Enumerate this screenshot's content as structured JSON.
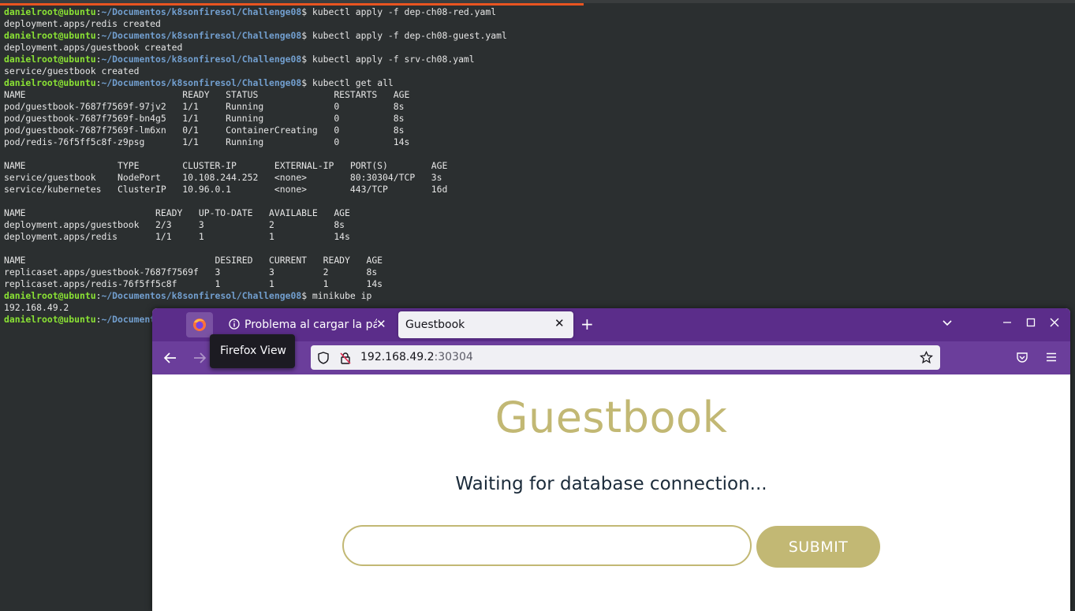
{
  "colors": {
    "terminal_bg": "#2b2f30",
    "prompt_user": "#8ae234",
    "prompt_path": "#729fcf",
    "firefox_tabbar": "#5b2d8a",
    "firefox_navbar": "#6b3e9b",
    "guestbook_accent": "#c2b874"
  },
  "terminal": {
    "prompt_user": "danielroot@ubuntu",
    "prompt_path": "~/Documentos/k8sonfiresol/Challenge08",
    "lines": [
      {
        "type": "prompt",
        "cmd": "$ kubectl apply -f dep-ch08-red.yaml"
      },
      {
        "type": "out",
        "text": "deployment.apps/redis created"
      },
      {
        "type": "prompt",
        "cmd": "$ kubectl apply -f dep-ch08-guest.yaml"
      },
      {
        "type": "out",
        "text": "deployment.apps/guestbook created"
      },
      {
        "type": "prompt",
        "cmd": "$ kubectl apply -f srv-ch08.yaml"
      },
      {
        "type": "out",
        "text": "service/guestbook created"
      },
      {
        "type": "prompt",
        "cmd": "$ kubectl get all"
      },
      {
        "type": "out",
        "text": "NAME                             READY   STATUS              RESTARTS   AGE"
      },
      {
        "type": "out",
        "text": "pod/guestbook-7687f7569f-97jv2   1/1     Running             0          8s"
      },
      {
        "type": "out",
        "text": "pod/guestbook-7687f7569f-bn4g5   1/1     Running             0          8s"
      },
      {
        "type": "out",
        "text": "pod/guestbook-7687f7569f-lm6xn   0/1     ContainerCreating   0          8s"
      },
      {
        "type": "out",
        "text": "pod/redis-76f5ff5c8f-z9psg       1/1     Running             0          14s"
      },
      {
        "type": "out",
        "text": ""
      },
      {
        "type": "out",
        "text": "NAME                 TYPE        CLUSTER-IP       EXTERNAL-IP   PORT(S)        AGE"
      },
      {
        "type": "out",
        "text": "service/guestbook    NodePort    10.108.244.252   <none>        80:30304/TCP   3s"
      },
      {
        "type": "out",
        "text": "service/kubernetes   ClusterIP   10.96.0.1        <none>        443/TCP        16d"
      },
      {
        "type": "out",
        "text": ""
      },
      {
        "type": "out",
        "text": "NAME                        READY   UP-TO-DATE   AVAILABLE   AGE"
      },
      {
        "type": "out",
        "text": "deployment.apps/guestbook   2/3     3            2           8s"
      },
      {
        "type": "out",
        "text": "deployment.apps/redis       1/1     1            1           14s"
      },
      {
        "type": "out",
        "text": ""
      },
      {
        "type": "out",
        "text": "NAME                                   DESIRED   CURRENT   READY   AGE"
      },
      {
        "type": "out",
        "text": "replicaset.apps/guestbook-7687f7569f   3         3         2       8s"
      },
      {
        "type": "out",
        "text": "replicaset.apps/redis-76f5ff5c8f       1         1         1       14s"
      },
      {
        "type": "prompt",
        "cmd": "$ minikube ip"
      },
      {
        "type": "out",
        "text": "192.168.49.2"
      },
      {
        "type": "prompt",
        "cmd": ""
      }
    ]
  },
  "browser": {
    "tabs": [
      {
        "title": "Problema al cargar la página",
        "icon": "info-icon",
        "active": false
      },
      {
        "title": "Guestbook",
        "active": true
      }
    ],
    "tooltip": "Firefox View",
    "url_host": "192.168.49.2",
    "url_port": ":30304"
  },
  "page": {
    "title": "Guestbook",
    "status": "Waiting for database connection...",
    "input_value": "",
    "submit_label": "SUBMIT"
  }
}
